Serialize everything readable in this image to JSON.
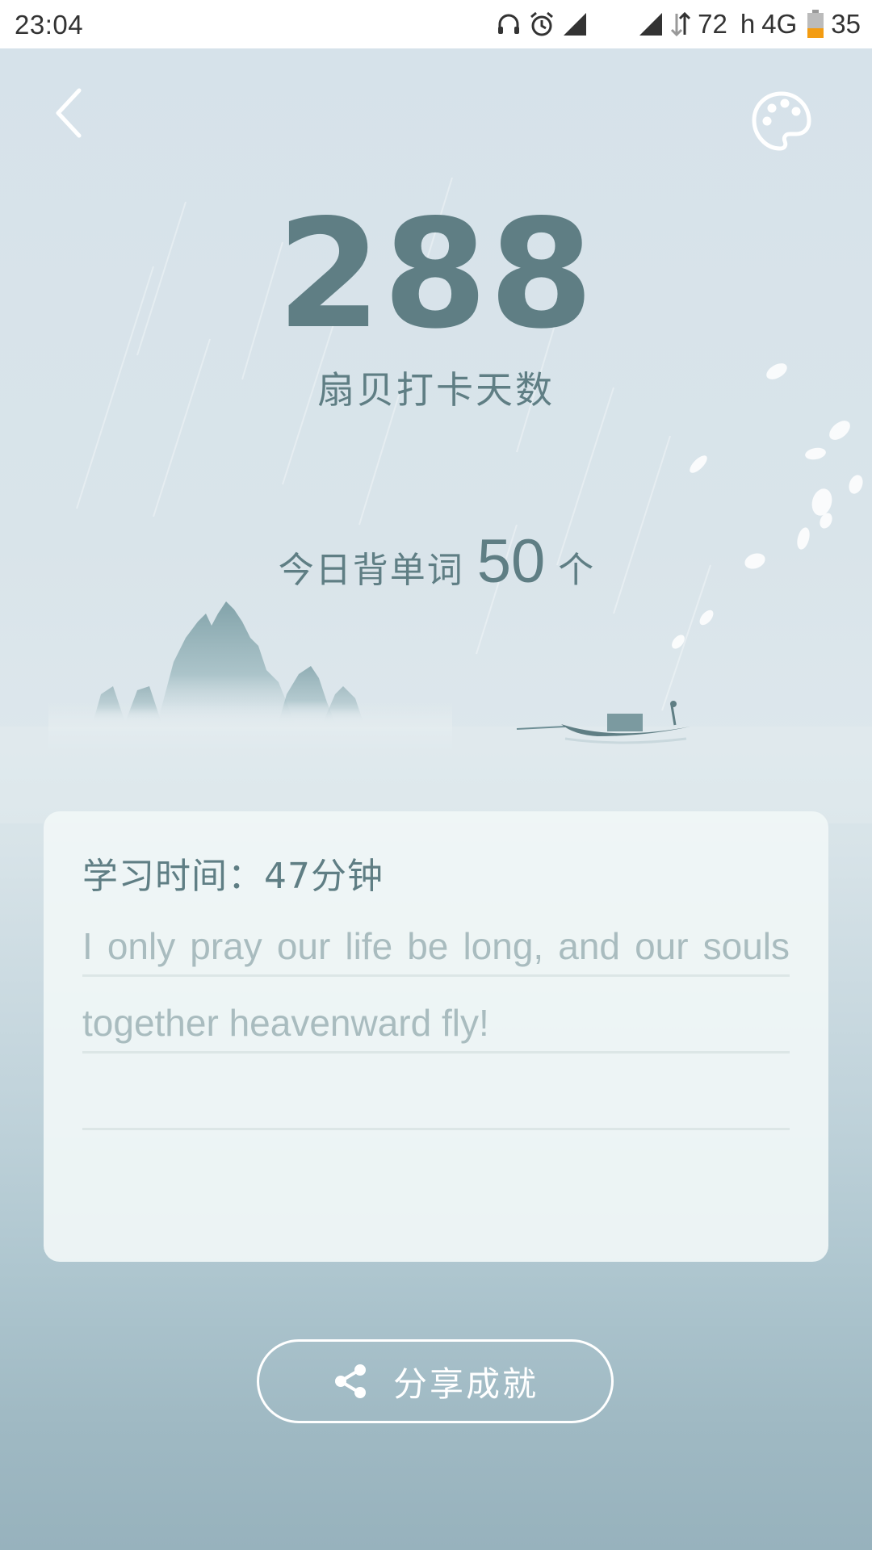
{
  "status_bar": {
    "time": "23:04",
    "network_speed": "72",
    "hd_label": "h",
    "network_type": "4G",
    "battery_level": "35",
    "icons": [
      "headset-icon",
      "alarm-icon",
      "signal-icon",
      "signal-icon",
      "data-arrows-icon",
      "battery-icon"
    ]
  },
  "header": {
    "back_icon": "chevron-left-icon",
    "theme_icon": "palette-icon"
  },
  "checkin": {
    "days": "288",
    "days_label": "扇贝打卡天数"
  },
  "today": {
    "prefix": "今日背单词",
    "count": "50",
    "suffix": "个"
  },
  "card": {
    "study_time": "学习时间：47分钟",
    "quote": "I only pray our life be long, and our souls together heavenward fly!"
  },
  "share": {
    "label": "分享成就",
    "icon": "share-icon"
  },
  "colors": {
    "primary_text": "#5f7e84",
    "quote_text": "#a9bcbf",
    "battery_fill": "#f39c12"
  }
}
